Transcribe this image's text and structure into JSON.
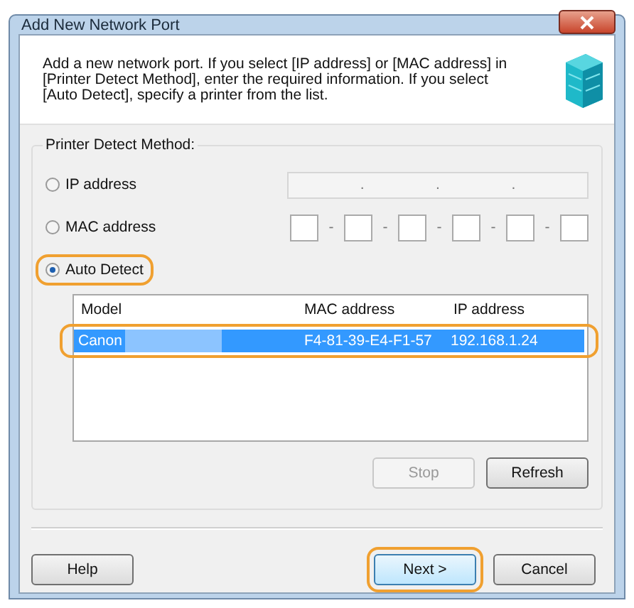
{
  "window": {
    "title": "Add New Network Port"
  },
  "header": {
    "description": "Add a new network port. If you select [IP address] or [MAC address] in [Printer Detect Method], enter the required information. If you select [Auto Detect], specify a printer from the list."
  },
  "detect_method": {
    "label": "Printer Detect Method:",
    "options": [
      {
        "kind": "ip",
        "label": "IP address",
        "selected": false,
        "highlighted": false,
        "separators": [
          ".",
          ".",
          "."
        ],
        "disabled": true
      },
      {
        "kind": "mac",
        "label": "MAC address",
        "selected": false,
        "highlighted": false,
        "separators": [
          "-",
          "-",
          "-",
          "-",
          "-"
        ],
        "disabled": false
      },
      {
        "kind": "auto",
        "label": "Auto Detect",
        "selected": true,
        "highlighted": true
      }
    ]
  },
  "table": {
    "columns": [
      "Model",
      "MAC address",
      "IP address"
    ],
    "rows": [
      {
        "model": "Canon",
        "model_obscured": true,
        "mac": "F4-81-39-E4-F1-57",
        "ip": "192.168.1.24",
        "selected": true,
        "highlighted": true
      }
    ]
  },
  "list_buttons": [
    {
      "label": "Stop",
      "disabled": true
    },
    {
      "label": "Refresh",
      "disabled": false
    }
  ],
  "footer_buttons": [
    {
      "kind": "left",
      "label": "Help",
      "default": false,
      "highlighted": false
    },
    {
      "kind": "right",
      "label": "Next >",
      "default": true,
      "highlighted": true
    },
    {
      "kind": "right",
      "label": "Cancel",
      "default": false,
      "highlighted": false
    }
  ]
}
